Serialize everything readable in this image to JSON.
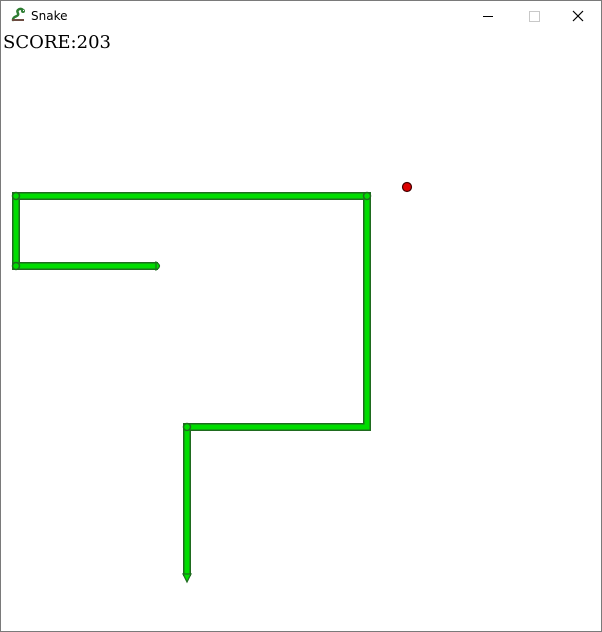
{
  "window": {
    "title": "Snake",
    "app_icon": "snake-icon",
    "controls": {
      "minimize": "minimize-icon",
      "maximize": "maximize-icon",
      "close": "close-icon"
    }
  },
  "game": {
    "score_text": "SCORE:203",
    "colors": {
      "snake_body": "#00dd00",
      "snake_outline": "#1f6b1f",
      "food": "#dd0000",
      "food_outline": "#440000"
    }
  }
}
